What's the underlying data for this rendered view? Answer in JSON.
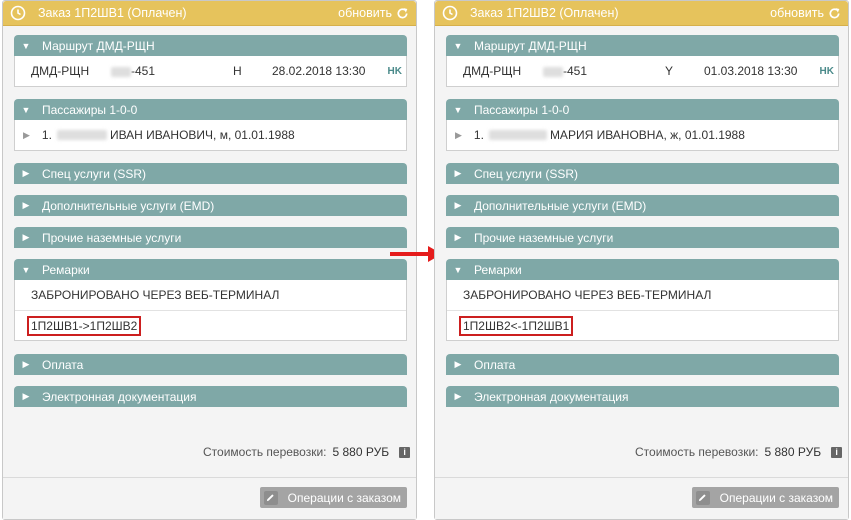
{
  "left": {
    "header_title": "Заказ 1П2ШВ1 (Оплачен)",
    "refresh_label": "обновить",
    "route_title": "Маршрут ДМД-РЩН",
    "route": {
      "city_pair": "ДМД-РЩН",
      "flight": "-451",
      "class": "Н",
      "datetime": "28.02.2018 13:30",
      "status": "HK"
    },
    "passengers_title": "Пассажиры 1-0-0",
    "passenger": {
      "num": "1.",
      "name": "ИВАН ИВАНОВИЧ, м, 01.01.1988"
    },
    "ssr_title": "Спец услуги (SSR)",
    "emd_title": "Дополнительные услуги (EMD)",
    "ground_title": "Прочие наземные услуги",
    "remarks_title": "Ремарки",
    "remark1": "ЗАБРОНИРОВАНО ЧЕРЕЗ ВЕБ-ТЕРМИНАЛ",
    "remark2": "1П2ШВ1->1П2ШВ2",
    "payment_title": "Оплата",
    "edocs_title": "Электронная документация",
    "cost_label": "Стоимость перевозки:",
    "cost_value": "5 880 РУБ",
    "ops_label": "Операции с заказом"
  },
  "right": {
    "header_title": "Заказ 1П2ШВ2 (Оплачен)",
    "refresh_label": "обновить",
    "route_title": "Маршрут ДМД-РЩН",
    "route": {
      "city_pair": "ДМД-РЩН",
      "flight": "-451",
      "class": "Y",
      "datetime": "01.03.2018 13:30",
      "status": "HK"
    },
    "passengers_title": "Пассажиры 1-0-0",
    "passenger": {
      "num": "1.",
      "name": "МАРИЯ ИВАНОВНА, ж, 01.01.1988"
    },
    "ssr_title": "Спец услуги (SSR)",
    "emd_title": "Дополнительные услуги (EMD)",
    "ground_title": "Прочие наземные услуги",
    "remarks_title": "Ремарки",
    "remark1": "ЗАБРОНИРОВАНО ЧЕРЕЗ ВЕБ-ТЕРМИНАЛ",
    "remark2": "1П2ШВ2<-1П2ШВ1",
    "payment_title": "Оплата",
    "edocs_title": "Электронная документация",
    "cost_label": "Стоимость перевозки:",
    "cost_value": "5 880 РУБ",
    "ops_label": "Операции с заказом"
  },
  "colors": {
    "header": "#e6c35c",
    "section": "#7fa8a7",
    "highlight": "#cc1f1f",
    "status": "#4a8a8a"
  },
  "icons": {
    "clock": "clock-icon",
    "refresh": "refresh-icon",
    "pencil": "pencil-icon",
    "info": "info-icon",
    "arrow": "red-arrow"
  }
}
